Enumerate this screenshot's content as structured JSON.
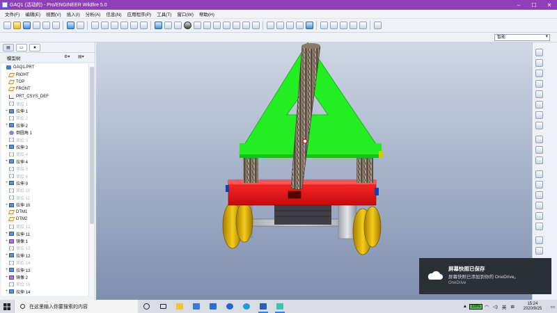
{
  "window": {
    "title": "GAQ1 (活动的) - Pro/ENGINEER Wildfire 5.0"
  },
  "menu": [
    "文件(F)",
    "编辑(E)",
    "视图(V)",
    "插入(I)",
    "分析(A)",
    "信息(N)",
    "应用程序(P)",
    "工具(T)",
    "窗口(W)",
    "帮助(H)"
  ],
  "filter": {
    "value": "智能"
  },
  "model_tree": {
    "header": "模型树",
    "items": [
      {
        "label": "GAQ1.PRT",
        "icon": "part-icon",
        "dim": false,
        "expand": ""
      },
      {
        "label": "RIGHT",
        "icon": "datum-plane-icon",
        "dim": false,
        "expand": ""
      },
      {
        "label": "TOP",
        "icon": "datum-plane-icon",
        "dim": false,
        "expand": ""
      },
      {
        "label": "FRONT",
        "icon": "datum-plane-icon",
        "dim": false,
        "expand": ""
      },
      {
        "label": "PRT_CSYS_DEF",
        "icon": "csys-icon",
        "dim": false,
        "expand": ""
      },
      {
        "label": "草绘 1",
        "icon": "sketch-icon",
        "dim": true,
        "expand": ""
      },
      {
        "label": "拉伸 1",
        "icon": "extrude-icon",
        "dim": false,
        "expand": "+"
      },
      {
        "label": "草绘 2",
        "icon": "sketch-icon",
        "dim": true,
        "expand": ""
      },
      {
        "label": "拉伸 2",
        "icon": "extrude-icon",
        "dim": false,
        "expand": "+"
      },
      {
        "label": "倒圆角 1",
        "icon": "round-icon",
        "dim": false,
        "expand": ""
      },
      {
        "label": "草绘 3",
        "icon": "sketch-icon",
        "dim": true,
        "expand": ""
      },
      {
        "label": "拉伸 3",
        "icon": "extrude-icon",
        "dim": false,
        "expand": "+"
      },
      {
        "label": "草绘 4",
        "icon": "sketch-icon",
        "dim": true,
        "expand": ""
      },
      {
        "label": "拉伸 4",
        "icon": "extrude-icon",
        "dim": false,
        "expand": "+"
      },
      {
        "label": "草绘 5",
        "icon": "sketch-icon",
        "dim": true,
        "expand": ""
      },
      {
        "label": "草绘 6",
        "icon": "sketch-icon",
        "dim": true,
        "expand": ""
      },
      {
        "label": "拉伸 9",
        "icon": "extrude-icon",
        "dim": false,
        "expand": "+"
      },
      {
        "label": "草绘 10",
        "icon": "sketch-icon",
        "dim": true,
        "expand": ""
      },
      {
        "label": "草绘 11",
        "icon": "sketch-icon",
        "dim": true,
        "expand": ""
      },
      {
        "label": "拉伸 10",
        "icon": "extrude-icon",
        "dim": false,
        "expand": "+"
      },
      {
        "label": "DTM1",
        "icon": "datum-plane-icon",
        "dim": false,
        "expand": ""
      },
      {
        "label": "DTM2",
        "icon": "datum-plane-icon",
        "dim": false,
        "expand": ""
      },
      {
        "label": "草绘 12",
        "icon": "sketch-icon",
        "dim": true,
        "expand": ""
      },
      {
        "label": "拉伸 11",
        "icon": "extrude-icon",
        "dim": false,
        "expand": "+"
      },
      {
        "label": "镜像 1",
        "icon": "mirror-icon",
        "dim": false,
        "expand": "+"
      },
      {
        "label": "草绘 13",
        "icon": "sketch-icon",
        "dim": true,
        "expand": ""
      },
      {
        "label": "拉伸 12",
        "icon": "extrude-icon",
        "dim": false,
        "expand": "+"
      },
      {
        "label": "草绘 14",
        "icon": "sketch-icon",
        "dim": true,
        "expand": ""
      },
      {
        "label": "拉伸 13",
        "icon": "extrude-icon",
        "dim": false,
        "expand": "+"
      },
      {
        "label": "镜像 2",
        "icon": "mirror-icon",
        "dim": false,
        "expand": "+"
      },
      {
        "label": "草绘 15",
        "icon": "sketch-icon",
        "dim": true,
        "expand": ""
      },
      {
        "label": "拉伸 14",
        "icon": "extrude-icon",
        "dim": false,
        "expand": "+"
      }
    ]
  },
  "toast": {
    "title": "屏幕快照已保存",
    "message": "屏幕快照已添加到你的 OneDrive。",
    "source": "OneDrive"
  },
  "taskbar": {
    "search_placeholder": "在这里输入你要搜索的内容",
    "battery": "100%",
    "ime": "英",
    "time": "15:24",
    "date": "2020/9/25"
  },
  "colors": {
    "titlebar": "#8f3fb8",
    "model_green": "#22ee22",
    "model_red": "#ee1111",
    "model_gold": "#e6b800"
  }
}
